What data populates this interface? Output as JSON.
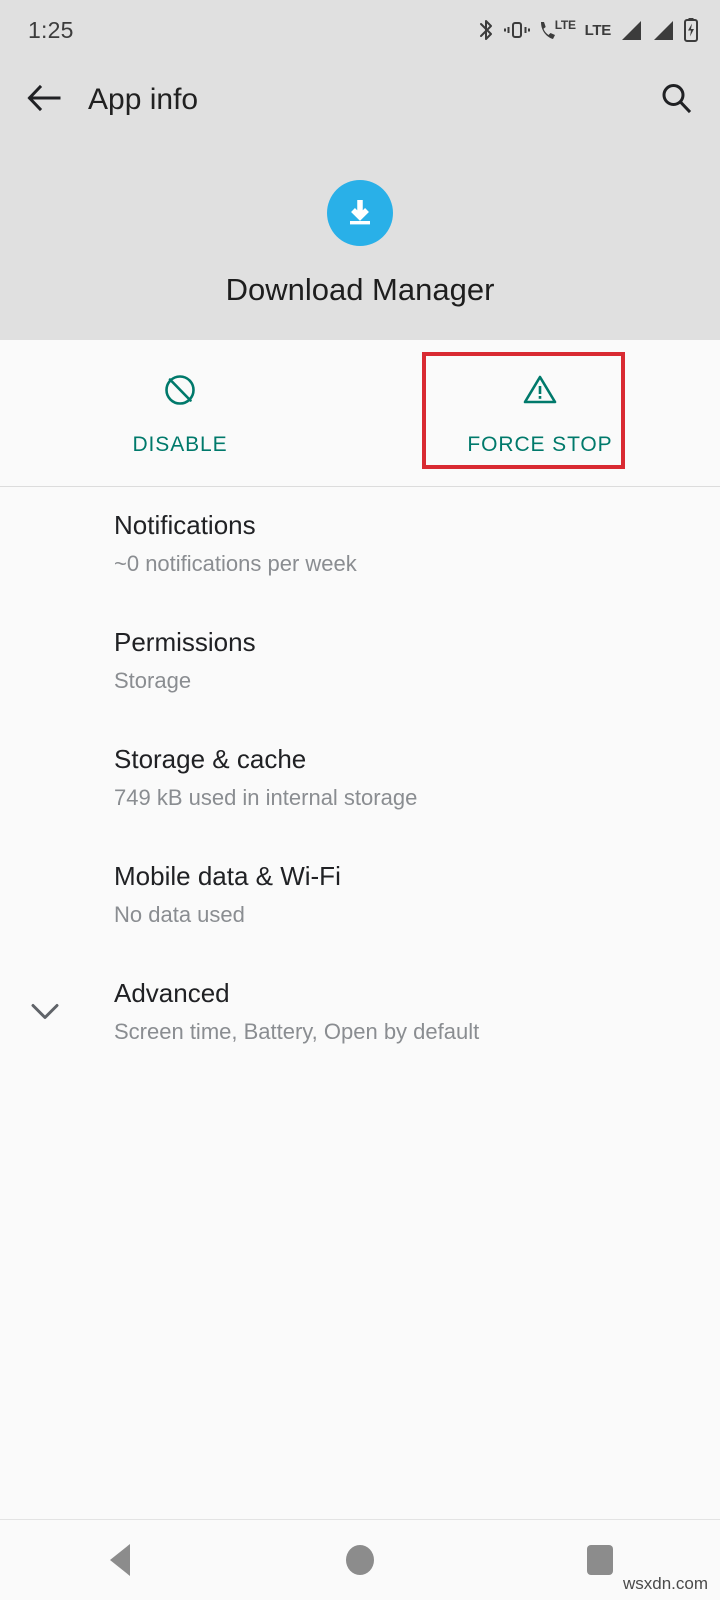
{
  "status_bar": {
    "time": "1:25",
    "icons": [
      "bluetooth-icon",
      "vibrate-icon",
      "volte-call-icon",
      "lte-label",
      "signal-bars-icon-1",
      "signal-bars-icon-2",
      "battery-charging-icon"
    ],
    "lte_label": "LTE",
    "volte_label": "LTE"
  },
  "app_bar": {
    "back_icon": "back-arrow-icon",
    "title": "App info",
    "search_icon": "search-icon"
  },
  "app_header": {
    "icon_name": "download-manager-icon",
    "icon_color": "#29B0E8",
    "app_name": "Download Manager"
  },
  "actions": {
    "accent_color": "#00796B",
    "highlight_color": "#D92A32",
    "buttons": [
      {
        "label": "DISABLE",
        "icon": "block-circle-slash-icon",
        "highlighted": false
      },
      {
        "label": "FORCE STOP",
        "icon": "warning-triangle-icon",
        "highlighted": true
      }
    ]
  },
  "settings_list": [
    {
      "title": "Notifications",
      "subtitle": "~0 notifications per week",
      "icon": ""
    },
    {
      "title": "Permissions",
      "subtitle": "Storage",
      "icon": ""
    },
    {
      "title": "Storage & cache",
      "subtitle": "749 kB used in internal storage",
      "icon": ""
    },
    {
      "title": "Mobile data & Wi-Fi",
      "subtitle": "No data used",
      "icon": ""
    },
    {
      "title": "Advanced",
      "subtitle": "Screen time, Battery, Open by default",
      "icon": "chevron-down-icon"
    }
  ],
  "nav_bar": {
    "back": "back-triangle-icon",
    "home": "home-circle-icon",
    "recents": "recents-square-icon"
  },
  "watermark": "wsxdn.com"
}
